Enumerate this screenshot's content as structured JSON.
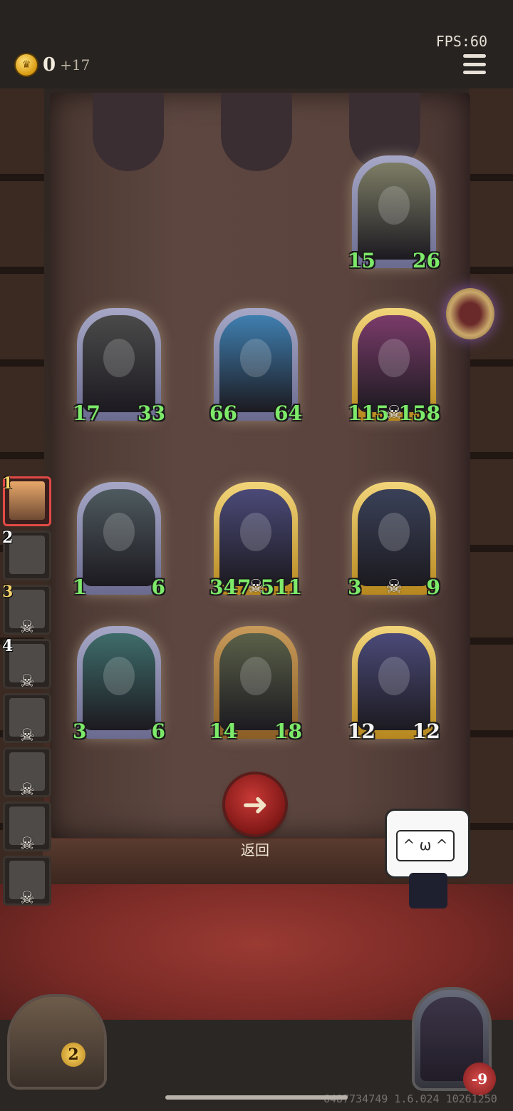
{
  "status": {
    "fps_label": "FPS:60"
  },
  "gold": {
    "value": "0",
    "income": "+17",
    "icon": "crown-coin-icon"
  },
  "menu": {
    "icon": "hamburger-menu-icon"
  },
  "colors": {
    "stat_green": "#7dea6a",
    "back_red": "#c83a37",
    "active_red": "#e14a46",
    "gold_frame": "#f2d57a",
    "silver_frame": "#a6a7c6"
  },
  "opponent_row": [
    {
      "atk": "15",
      "hp": "26",
      "frame": "silver",
      "art": "#7d7d66"
    }
  ],
  "board_rows": [
    [
      {
        "atk": "17",
        "hp": "33",
        "frame": "silver",
        "art": "#4a4a4a",
        "skull": false
      },
      {
        "atk": "66",
        "hp": "64",
        "frame": "silver",
        "art": "#3f7fb0",
        "skull": false
      },
      {
        "atk": "115",
        "hp": "158",
        "frame": "gold",
        "art": "#7a3b6a",
        "skull": true
      }
    ],
    [
      {
        "atk": "1",
        "hp": "6",
        "frame": "silver",
        "art": "#4e5a5f",
        "skull": false
      },
      {
        "atk": "347",
        "hp": "511",
        "frame": "gold",
        "art": "#4b4a78",
        "skull": true
      },
      {
        "atk": "3",
        "hp": "9",
        "frame": "gold",
        "art": "#3a4158",
        "skull": true
      }
    ],
    [
      {
        "atk": "3",
        "hp": "6",
        "frame": "silver",
        "art": "#3e6c6a",
        "skull": false
      },
      {
        "atk": "14",
        "hp": "18",
        "frame": "bronze",
        "art": "#5a6048",
        "skull": false
      },
      {
        "atk": "12",
        "hp": "12",
        "frame": "gold",
        "art": "#4b4a78",
        "skull": false,
        "white": true
      }
    ]
  ],
  "sidebar": [
    {
      "num": "1",
      "active": true,
      "skull": false
    },
    {
      "num": "2",
      "active": false,
      "skull": false
    },
    {
      "num": "3",
      "active": false,
      "skull": true,
      "num_gold": true
    },
    {
      "num": "4",
      "active": false,
      "skull": true
    },
    {
      "num": "",
      "active": false,
      "skull": true
    },
    {
      "num": "",
      "active": false,
      "skull": true
    },
    {
      "num": "",
      "active": false,
      "skull": true
    },
    {
      "num": "",
      "active": false,
      "skull": true
    }
  ],
  "back_button": {
    "label": "返回",
    "icon": "arrow-left-icon"
  },
  "mascot": {
    "face": "^ ω ^",
    "icon": "bilibili-tv-mascot-icon"
  },
  "chest": {
    "level": "2",
    "icon": "treasure-chest-icon"
  },
  "hero": {
    "hp": "-9",
    "icon": "wizard-portrait-icon"
  },
  "watch": {
    "icon": "pocket-watch-icon"
  },
  "build_id": "6487734749 1.6.024 10261250"
}
